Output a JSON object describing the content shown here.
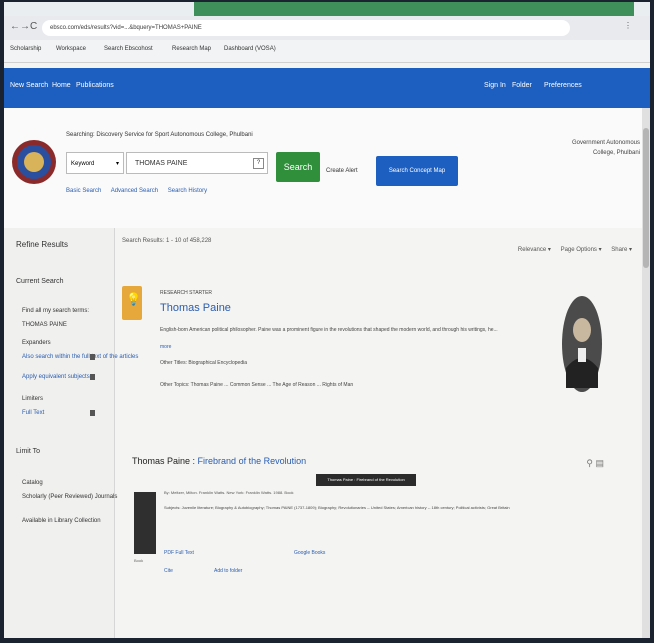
{
  "browser": {
    "address": "ebsco.com/eds/results?vid=...&bquery=THOMAS+PAINE",
    "nav_back": "←",
    "nav_forward": "→",
    "nav_reload": "C",
    "menu_dots": "⋮",
    "bookmarks": [
      "Scholarship",
      "Workspace",
      "Search Ebscohost",
      "Research Map",
      "Dashboard (VOSA)"
    ]
  },
  "site_nav": {
    "items": [
      "New Search",
      "Home",
      "Publications"
    ],
    "right": [
      "Sign In",
      "Folder",
      "Preferences"
    ]
  },
  "header": {
    "institution": "Searching: Discovery Service for Sport Autonomous College, Phulbani",
    "search_type": "Keyword",
    "search_type_caret": "▾",
    "search_value": "THOMAS PAINE",
    "search_button": "Search",
    "clear_link": "Create Alert",
    "concept_button": "Search Concept Map",
    "sublinks": [
      "Basic Search",
      "Advanced Search",
      "Search History"
    ],
    "right_institution_line1": "Government Autonomous",
    "right_institution_line2": "College, Phulbani"
  },
  "sidebar": {
    "refine": "Refine Results",
    "current_search": "Current Search",
    "find_all": "Find all my search terms:",
    "find_value": "THOMAS PAINE",
    "expanders": "Expanders",
    "expander1": "Also search within the full text of the articles",
    "expander2": "Apply equivalent subjects",
    "limit_to": "Limit To",
    "limiters": "Limiters",
    "full_text": "Full Text",
    "catalog": "Catalog",
    "peer_reviewed": "Scholarly (Peer Reviewed) Journals",
    "available_in": "Available in Library Collection"
  },
  "results": {
    "count": "Search Results: 1 - 10 of 458,228",
    "sort": [
      "Relevance ▾",
      "Page Options ▾",
      "Share ▾"
    ],
    "research_starter": {
      "label": "RESEARCH STARTER",
      "title": "Thomas Paine",
      "description": "English-born American political philosopher. Paine was a prominent figure in the revolutions that shaped the modern world, and through his writings, he...",
      "more": "more",
      "other": "Other Titles: Biographical Encyclopedia",
      "topics": "Other Topics: Thomas Paine ... Common Sense ... The Age of Reason ... Rights of Man"
    },
    "item": {
      "title_prefix": "Thomas Paine :",
      "title_rest": "Firebrand of the Revolution",
      "tooltip": "Thomas Paine : Firebrand of the Revolution",
      "by": "By: Meltzer, Milton. Franklin Watts. New York: Franklin Watts. 1988. Book",
      "subjects": "Subjects: Juvenile literature; Biography & Autobiography; Thomas PAINE (1737-1809); Biography; Revolutionaries -- United States; American history -- 18th century; Political activists; Great Britain",
      "book_label": "Book",
      "link1": "PDF Full Text",
      "link2": "Google Books",
      "link3": "Cite",
      "link4": "Add to folder"
    }
  },
  "colors": {
    "nav_blue": "#1d5fc0",
    "search_green": "#2f8f3a",
    "bulb_orange": "#e7a83b"
  }
}
